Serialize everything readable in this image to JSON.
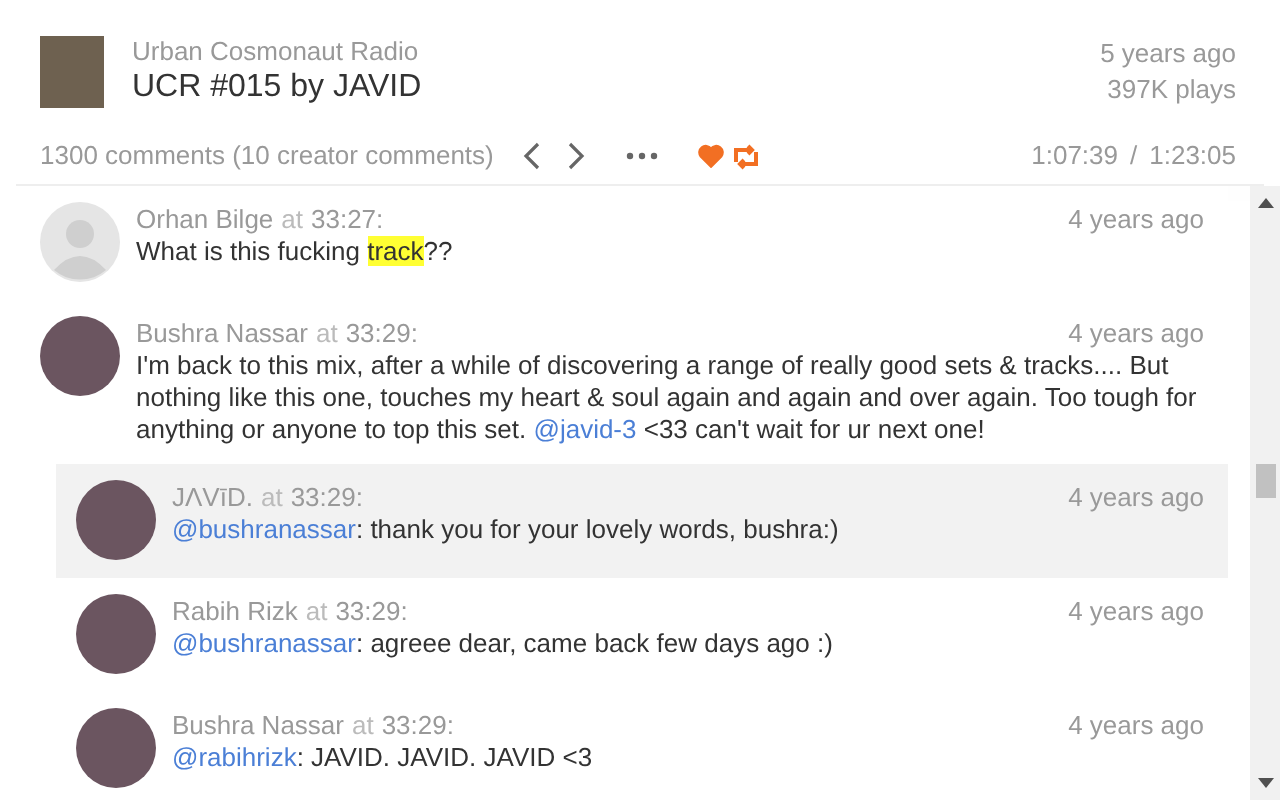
{
  "track": {
    "artist": "Urban Cosmonaut Radio",
    "title": "UCR #015 by JAVID",
    "posted": "5 years ago",
    "plays": "397K plays"
  },
  "toolbar": {
    "comments_count": "1300 comments (10 creator comments)",
    "liked": true,
    "reposted": true,
    "position": "1:07:39",
    "separator": "/",
    "duration": "1:23:05"
  },
  "comments": [
    {
      "author": "Orhan Bilge",
      "at": "at",
      "time": "33:27:",
      "ago": "4 years ago",
      "kind": "silhouette",
      "selected": false,
      "body": [
        {
          "kind": "text",
          "text": "What is this fucking "
        },
        {
          "kind": "highlight",
          "text": "track"
        },
        {
          "kind": "text",
          "text": "??"
        }
      ]
    },
    {
      "author": "Bushra Nassar",
      "at": "at",
      "time": "33:29:",
      "ago": "4 years ago",
      "kind": "photo",
      "selected": false,
      "body": [
        {
          "kind": "text",
          "text": "I'm back to this mix, after a while of discovering a range of really good sets & tracks.... But nothing like this one, touches my heart & soul again and again and over again. Too tough for anything or anyone to top this set. "
        },
        {
          "kind": "mention",
          "text": "@javid-3"
        },
        {
          "kind": "text",
          "text": " <33 can't wait for ur next one!"
        }
      ],
      "children": [
        {
          "author": "JΛVīD.",
          "at": "at",
          "time": "33:29:",
          "ago": "4 years ago",
          "kind": "photo",
          "selected": true,
          "body": [
            {
              "kind": "mention",
              "text": "@bushranassar"
            },
            {
              "kind": "text",
              "text": ": thank you for your lovely words, bushra:)"
            }
          ]
        },
        {
          "author": "Rabih Rizk",
          "at": "at",
          "time": "33:29:",
          "ago": "4 years ago",
          "kind": "photo",
          "selected": false,
          "body": [
            {
              "kind": "mention",
              "text": "@bushranassar"
            },
            {
              "kind": "text",
              "text": ": agreee dear, came back few days ago :)"
            }
          ]
        },
        {
          "author": "Bushra Nassar",
          "at": "at",
          "time": "33:29:",
          "ago": "4 years ago",
          "kind": "photo",
          "selected": false,
          "body": [
            {
              "kind": "mention",
              "text": "@rabihrizk"
            },
            {
              "kind": "text",
              "text": ": JAVID. JAVID. JAVID <3"
            }
          ]
        }
      ]
    }
  ]
}
